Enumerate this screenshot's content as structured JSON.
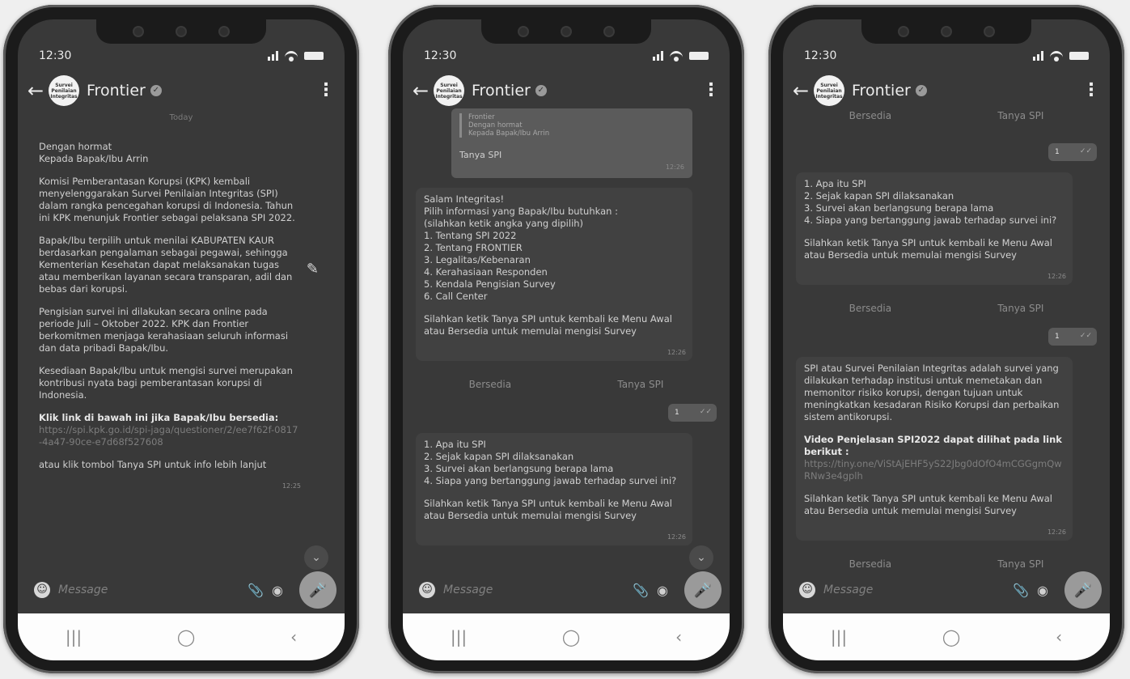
{
  "status": {
    "time": "12:30"
  },
  "header": {
    "name": "Frontier",
    "avatar_text": [
      "Survei",
      "Penilaian",
      "Integritas"
    ]
  },
  "composer": {
    "placeholder": "Message"
  },
  "phone1": {
    "date_chip": "Today",
    "greeting": "Dengan hormat",
    "to": "Kepada Bapak/Ibu Arrin",
    "p1": "Komisi Pemberantasan Korupsi (KPK) kembali menyelenggarakan Survei Penilaian Integritas (SPI) dalam rangka pencegahan korupsi di Indonesia. Tahun ini KPK menunjuk Frontier sebagai pelaksana SPI 2022.",
    "p2": "Bapak/Ibu terpilih untuk menilai KABUPATEN KAUR berdasarkan pengalaman sebagai pegawai, sehingga Kementerian Kesehatan dapat melaksanakan tugas atau memberikan layanan secara transparan, adil dan bebas dari korupsi.",
    "p3": "Pengisian survei ini dilakukan secara online pada periode Juli – Oktober 2022. KPK dan Frontier berkomitmen menjaga kerahasiaan seluruh informasi dan data pribadi Bapak/Ibu.",
    "p4": "Kesediaan Bapak/Ibu untuk mengisi survei merupakan kontribusi nyata bagi pemberantasan korupsi di Indonesia.",
    "p5": "Klik link di bawah ini jika Bapak/Ibu bersedia:",
    "link": "https://spi.kpk.go.id/spi-jaga/questioner/2/ee7f62f-0817-4a47-90ce-e7d68f527608",
    "p6": "atau klik tombol Tanya SPI untuk info lebih lanjut",
    "time": "12:25"
  },
  "phone2": {
    "quote_sender": "Frontier",
    "quote_line1": "Dengan hormat",
    "quote_line2": "Kepada Bapak/Ibu Arrin",
    "quote_reply": "Tanya SPI",
    "quote_time": "12:26",
    "salam": "Salam Integritas!",
    "pilih": "Pilih informasi yang Bapak/Ibu butuhkan :",
    "ketik": "(silahkan ketik angka yang dipilih)",
    "menu": [
      "1. Tentang SPI 2022",
      "2. Tentang FRONTIER",
      "3. Legalitas/Kebenaran",
      "4. Kerahasiaan Responden",
      "5. Kendala Pengisian Survey",
      "6. Call Center"
    ],
    "instr": "Silahkan ketik Tanya SPI untuk kembali ke Menu Awal atau Bersedia untuk memulai mengisi Survey",
    "time1": "12:26",
    "btn_a": "Bersedia",
    "btn_b": "Tanya SPI",
    "out1": "1",
    "out1_time": "12:26",
    "sub": [
      "1. Apa itu SPI",
      "2. Sejak kapan SPI dilaksanakan",
      "3. Survei akan berlangsung berapa lama",
      "4. Siapa yang bertanggung jawab terhadap survei ini?"
    ],
    "time2": "12:26"
  },
  "phone3": {
    "out_top": "1",
    "out_top_time": "12:26",
    "sub": [
      "1. Apa itu SPI",
      "2. Sejak kapan SPI dilaksanakan",
      "3. Survei akan berlangsung berapa lama",
      "4. Siapa yang bertanggung jawab terhadap survei ini?"
    ],
    "instr": "Silahkan ketik Tanya SPI untuk kembali ke Menu Awal atau Bersedia untuk memulai mengisi Survey",
    "time1": "12:26",
    "btn_a": "Bersedia",
    "btn_b": "Tanya SPI",
    "out2": "1",
    "out2_time": "12:26",
    "desc": "SPI atau Survei Penilaian Integritas adalah survei yang dilakukan terhadap institusi untuk memetakan dan memonitor risiko korupsi, dengan tujuan untuk meningkatkan kesadaran Risiko Korupsi dan perbaikan sistem antikorupsi.",
    "video_label": "Video Penjelasan SPI2022 dapat dilihat pada link berikut :",
    "video_link": "https://tiny.one/ViStAjEHF5yS22Jbg0dOfO4mCGGgmQwRNw3e4gplh",
    "instr2": "Silahkan ketik Tanya SPI untuk kembali ke Menu Awal atau Bersedia untuk memulai mengisi Survey",
    "time2": "12:26"
  }
}
